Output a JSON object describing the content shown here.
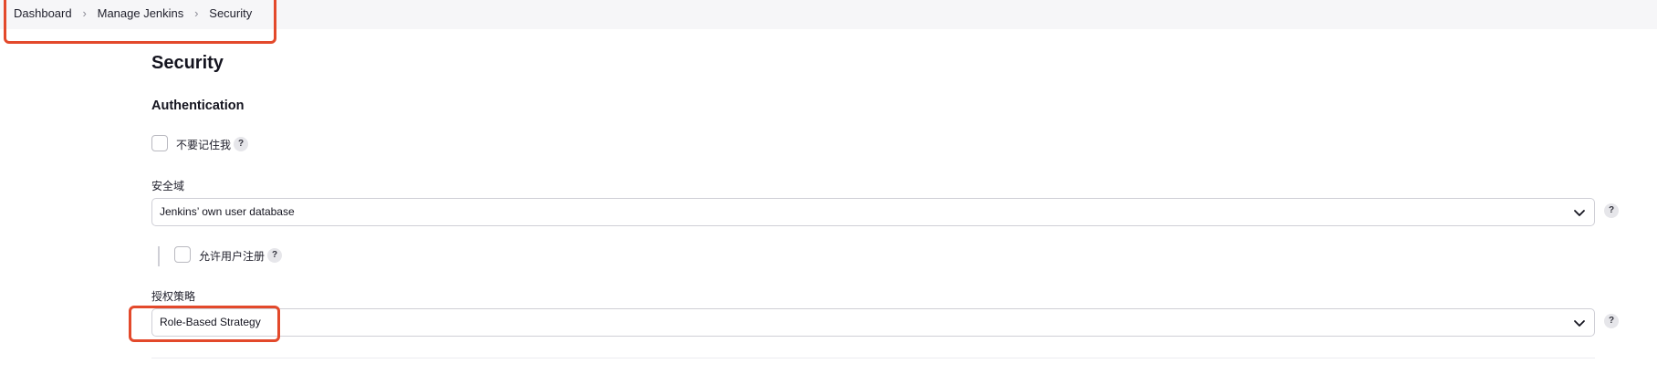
{
  "breadcrumb": {
    "items": [
      "Dashboard",
      "Manage Jenkins",
      "Security"
    ],
    "separator": ">"
  },
  "page": {
    "title": "Security"
  },
  "authentication": {
    "section_title": "Authentication",
    "remember_me": {
      "label": "不要记住我",
      "checked": false,
      "help": "?"
    },
    "security_realm": {
      "label": "安全域",
      "selected": "Jenkins’ own user database",
      "help": "?"
    },
    "allow_signup": {
      "label": "允许用户注册",
      "checked": false,
      "help": "?"
    },
    "authorization": {
      "label": "授权策略",
      "selected": "Role-Based Strategy",
      "help": "?"
    }
  },
  "colors": {
    "annotation": "#e3492b",
    "breadcrumb_bg": "#f6f6f8",
    "border": "#cfcfd6"
  },
  "icons": {
    "chevron": "chevron-down-icon",
    "separator": "chevron-right-icon",
    "help": "help-icon"
  }
}
